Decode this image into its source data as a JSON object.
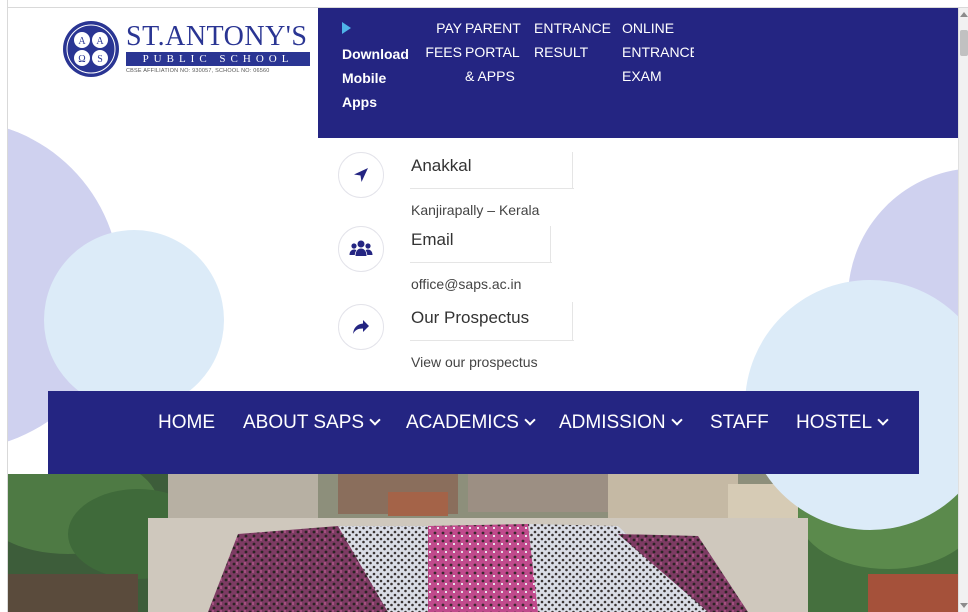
{
  "header": {
    "school_name": "ST.ANTONY'S",
    "school_sub": "PUBLIC SCHOOL",
    "affiliation": "CBSE AFFILIATION NO: 930057, SCHOOL NO: 06560",
    "emblem_letters": [
      "A",
      "Ω",
      "S",
      "A"
    ]
  },
  "topbar": {
    "download": [
      "Download",
      "Mobile",
      "Apps"
    ],
    "pay": [
      "PAY",
      "FEES"
    ],
    "parent": [
      "PARENT",
      "PORTAL",
      "& APPS"
    ],
    "entrance_result": [
      "ENTRANCE",
      "RESULT"
    ],
    "online_entrance": [
      "ONLINE",
      "ENTRANCE",
      "EXAM"
    ]
  },
  "contact": {
    "location_title": "Anakkal",
    "location_sub": "Kanjirapally – Kerala",
    "email_title": "Email",
    "email_sub": "office@saps.ac.in",
    "prospectus_title": "Our Prospectus",
    "prospectus_sub": "View our prospectus"
  },
  "nav": {
    "home": "HOME",
    "about": "ABOUT SAPS",
    "academics": "ACADEMICS",
    "admission": "ADMISSION",
    "staff": "STAFF",
    "hostel": "HOSTEL"
  },
  "colors": {
    "brand_navy": "#242582",
    "logo_blue": "#2a3593",
    "deco_lavender": "#cfd1ef",
    "deco_lightblue": "#dcebf8"
  }
}
